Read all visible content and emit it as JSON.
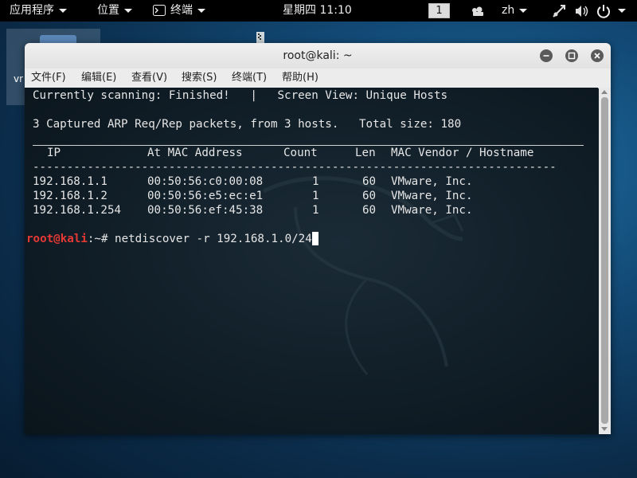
{
  "topbar": {
    "apps_label": "应用程序",
    "places_label": "位置",
    "terminal_label": "终端",
    "clock": "星期四 11:10",
    "workspace": "1",
    "lang": "zh"
  },
  "desktop": {
    "icon1_label": "vr"
  },
  "window": {
    "title": "root@kali: ~",
    "menu": [
      "文件(F)",
      "编辑(E)",
      "查看(V)",
      "搜索(S)",
      "终端(T)",
      "帮助(H)"
    ]
  },
  "terminal": {
    "status_line": "Currently scanning: Finished!   |   Screen View: Unique Hosts",
    "summary_line": "3 Captured ARP Req/Rep packets, from 3 hosts.   Total size: 180",
    "columns": [
      "IP",
      "At MAC Address",
      "Count",
      "Len",
      "MAC Vendor / Hostname"
    ],
    "separator": "-----------------------------------------------------------------------------",
    "rows": [
      {
        "ip": "192.168.1.1",
        "mac": "00:50:56:c0:00:08",
        "count": "1",
        "len": "60",
        "vendor": "VMware, Inc."
      },
      {
        "ip": "192.168.1.2",
        "mac": "00:50:56:e5:ec:e1",
        "count": "1",
        "len": "60",
        "vendor": "VMware, Inc."
      },
      {
        "ip": "192.168.1.254",
        "mac": "00:50:56:ef:45:38",
        "count": "1",
        "len": "60",
        "vendor": "VMware, Inc."
      }
    ],
    "prompt_user": "root@kali",
    "prompt_path": ":~# ",
    "command": "netdiscover -r 192.168.1.0/24"
  }
}
